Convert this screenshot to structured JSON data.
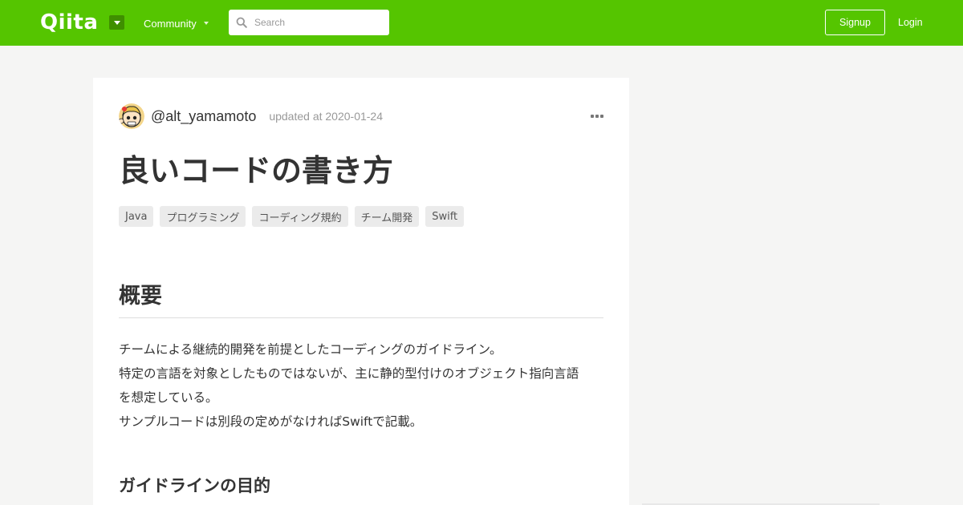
{
  "header": {
    "logo": "Qiita",
    "community_label": "Community",
    "search_placeholder": "Search",
    "signup_label": "Signup",
    "login_label": "Login",
    "colors": {
      "brand": "#55c500",
      "dropdown": "#3f8f00"
    },
    "icons": [
      "chevron-down-icon",
      "search-icon"
    ]
  },
  "article": {
    "author": "@alt_yamamoto",
    "updated": "updated at 2020-01-24",
    "title": "良いコードの書き方",
    "tags": [
      "Java",
      "プログラミング",
      "コーディング規約",
      "チーム開発",
      "Swift"
    ],
    "sections": [
      {
        "heading": "概要",
        "paragraphs": [
          "チームによる継続的開発を前提としたコーディングのガイドライン。",
          "特定の言語を対象としたものではないが、主に静的型付けのオブジェクト指向言語",
          "を想定している。",
          "サンプルコードは別段の定めがなければSwiftで記載。"
        ]
      },
      {
        "heading": "ガイドラインの目的"
      }
    ],
    "icons": [
      "avatar-icon",
      "more-icon"
    ]
  }
}
